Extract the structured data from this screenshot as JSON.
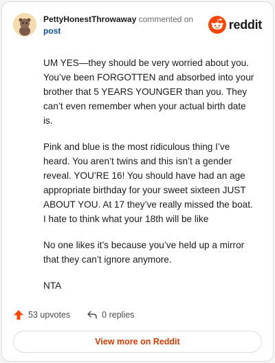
{
  "comment": {
    "username": "PettyHonestThrowaway",
    "action_text": "commented on",
    "post_link": "post",
    "paragraphs": [
      "UM YES—they should be very worried about you. You’ve been FORGOTTEN and absorbed into your brother that 5 YEARS YOUNGER than you. They can’t even remember when your actual birth date is.",
      "Pink and blue is the most ridiculous thing I’ve heard. You aren’t twins and this isn’t a gender reveal. YOU’RE 16! You should have had an age appropriate birthday for your sweet sixteen JUST ABOUT YOU. At 17 they’ve really missed the boat. I hate to think what your 18th will be like",
      "No one likes it’s because you’ve held up a mirror that they can’t ignore anymore.",
      "NTA"
    ]
  },
  "brand": {
    "name": "reddit",
    "color": "#ff4500"
  },
  "actions": {
    "upvotes": "53 upvotes",
    "replies": "0 replies"
  },
  "footer": {
    "view_more": "View more on Reddit"
  },
  "colors": {
    "accent": "#d93a00",
    "link": "#0a4f9e",
    "upvote": "#ff4500"
  }
}
